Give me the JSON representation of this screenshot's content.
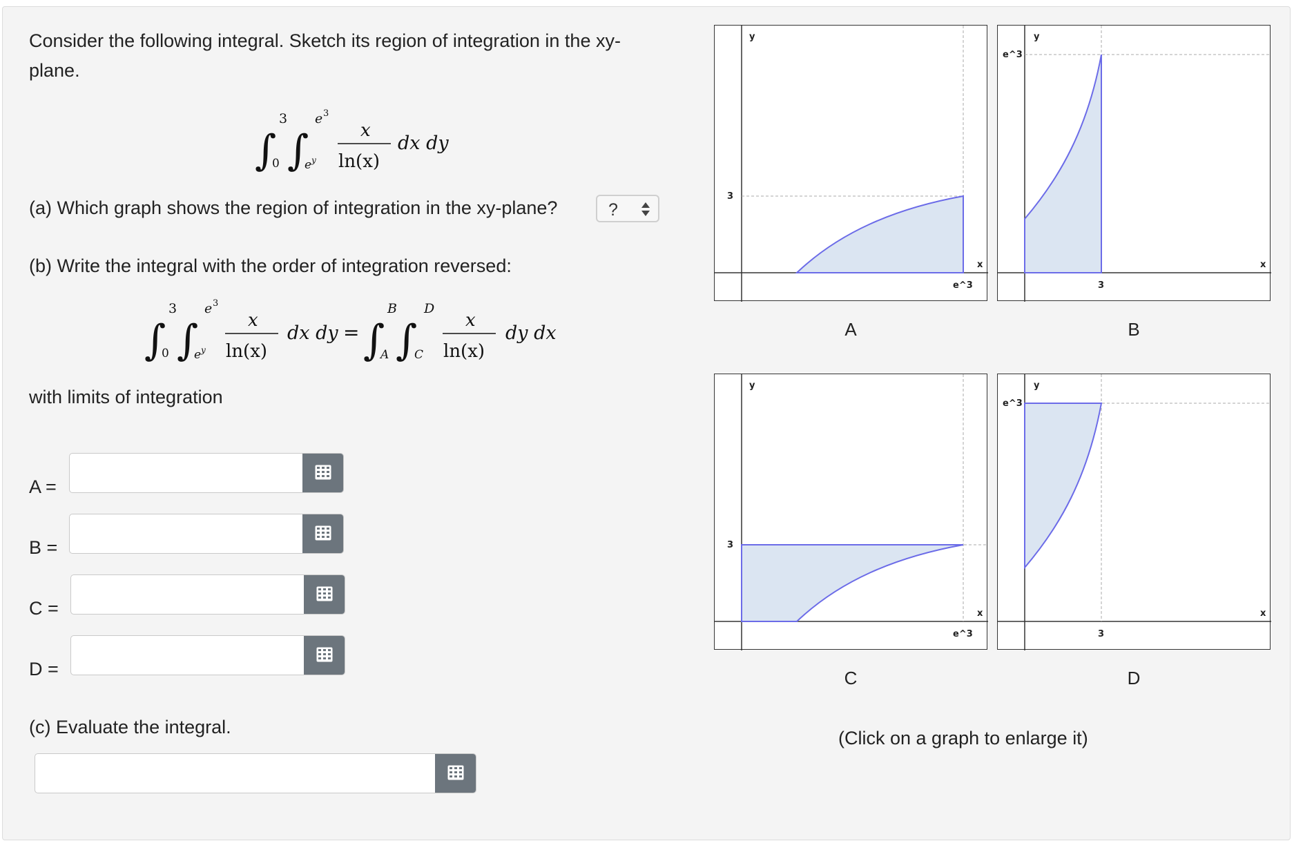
{
  "question": {
    "intro": "Consider the following integral. Sketch its region of integration in the xy-plane.",
    "integral": {
      "outer_lower": "0",
      "outer_upper": "3",
      "inner_lower": "e",
      "inner_lower_exp": "y",
      "inner_upper": "e",
      "inner_upper_exp": "3",
      "numerator": "x",
      "denominator": "ln(x)",
      "differentials": "dx dy"
    },
    "part_a": {
      "text": "(a) Which graph shows the region of integration in the xy-plane?",
      "selected": "?"
    },
    "part_b": {
      "text": "(b) Write the integral with the order of integration reversed:",
      "reversed": {
        "outer_lower": "A",
        "outer_upper": "B",
        "inner_lower": "C",
        "inner_upper": "D",
        "differentials": "dy dx",
        "equals": "="
      },
      "limits_label": "with limits of integration",
      "fields": [
        {
          "label": "A =",
          "value": ""
        },
        {
          "label": "B =",
          "value": ""
        },
        {
          "label": "C =",
          "value": ""
        },
        {
          "label": "D =",
          "value": ""
        }
      ]
    },
    "part_c": {
      "text": "(c) Evaluate the integral.",
      "value": ""
    }
  },
  "graphs": [
    {
      "caption": "A",
      "axis_x": "x",
      "axis_y": "y",
      "tick_x": "e^3",
      "tick_y": "3"
    },
    {
      "caption": "B",
      "axis_x": "x",
      "axis_y": "y",
      "tick_x": "3",
      "tick_y": "e^3"
    },
    {
      "caption": "C",
      "axis_x": "x",
      "axis_y": "y",
      "tick_x": "e^3",
      "tick_y": "3"
    },
    {
      "caption": "D",
      "axis_x": "x",
      "axis_y": "y",
      "tick_x": "3",
      "tick_y": "e^3"
    }
  ],
  "enlarge_note": "(Click on a graph to enlarge it)",
  "colors": {
    "panel_bg": "#f4f4f4",
    "region_fill": "#dbe5f2",
    "region_stroke": "#6b6be8",
    "button_gray": "#6c757d"
  },
  "icons": {
    "keyboard": "keyboard-icon",
    "select_arrows": "chevron-updown-icon"
  }
}
